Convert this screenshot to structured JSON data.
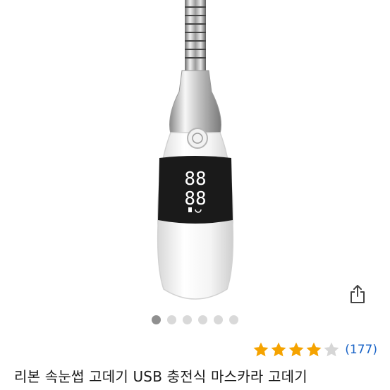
{
  "product": {
    "image_alt": "eyelash curler",
    "title": "리본 속눈썹 고데기 USB 충전식 마스카라 고데기",
    "display_digits": "88",
    "rating": {
      "stars": 4,
      "max": 5,
      "count_label": "(177)",
      "star_color": "#f5a300",
      "empty_color": "#d6d6d6"
    }
  },
  "carousel": {
    "total": 6,
    "active_index": 0
  },
  "icons": {
    "share": "share-icon"
  }
}
